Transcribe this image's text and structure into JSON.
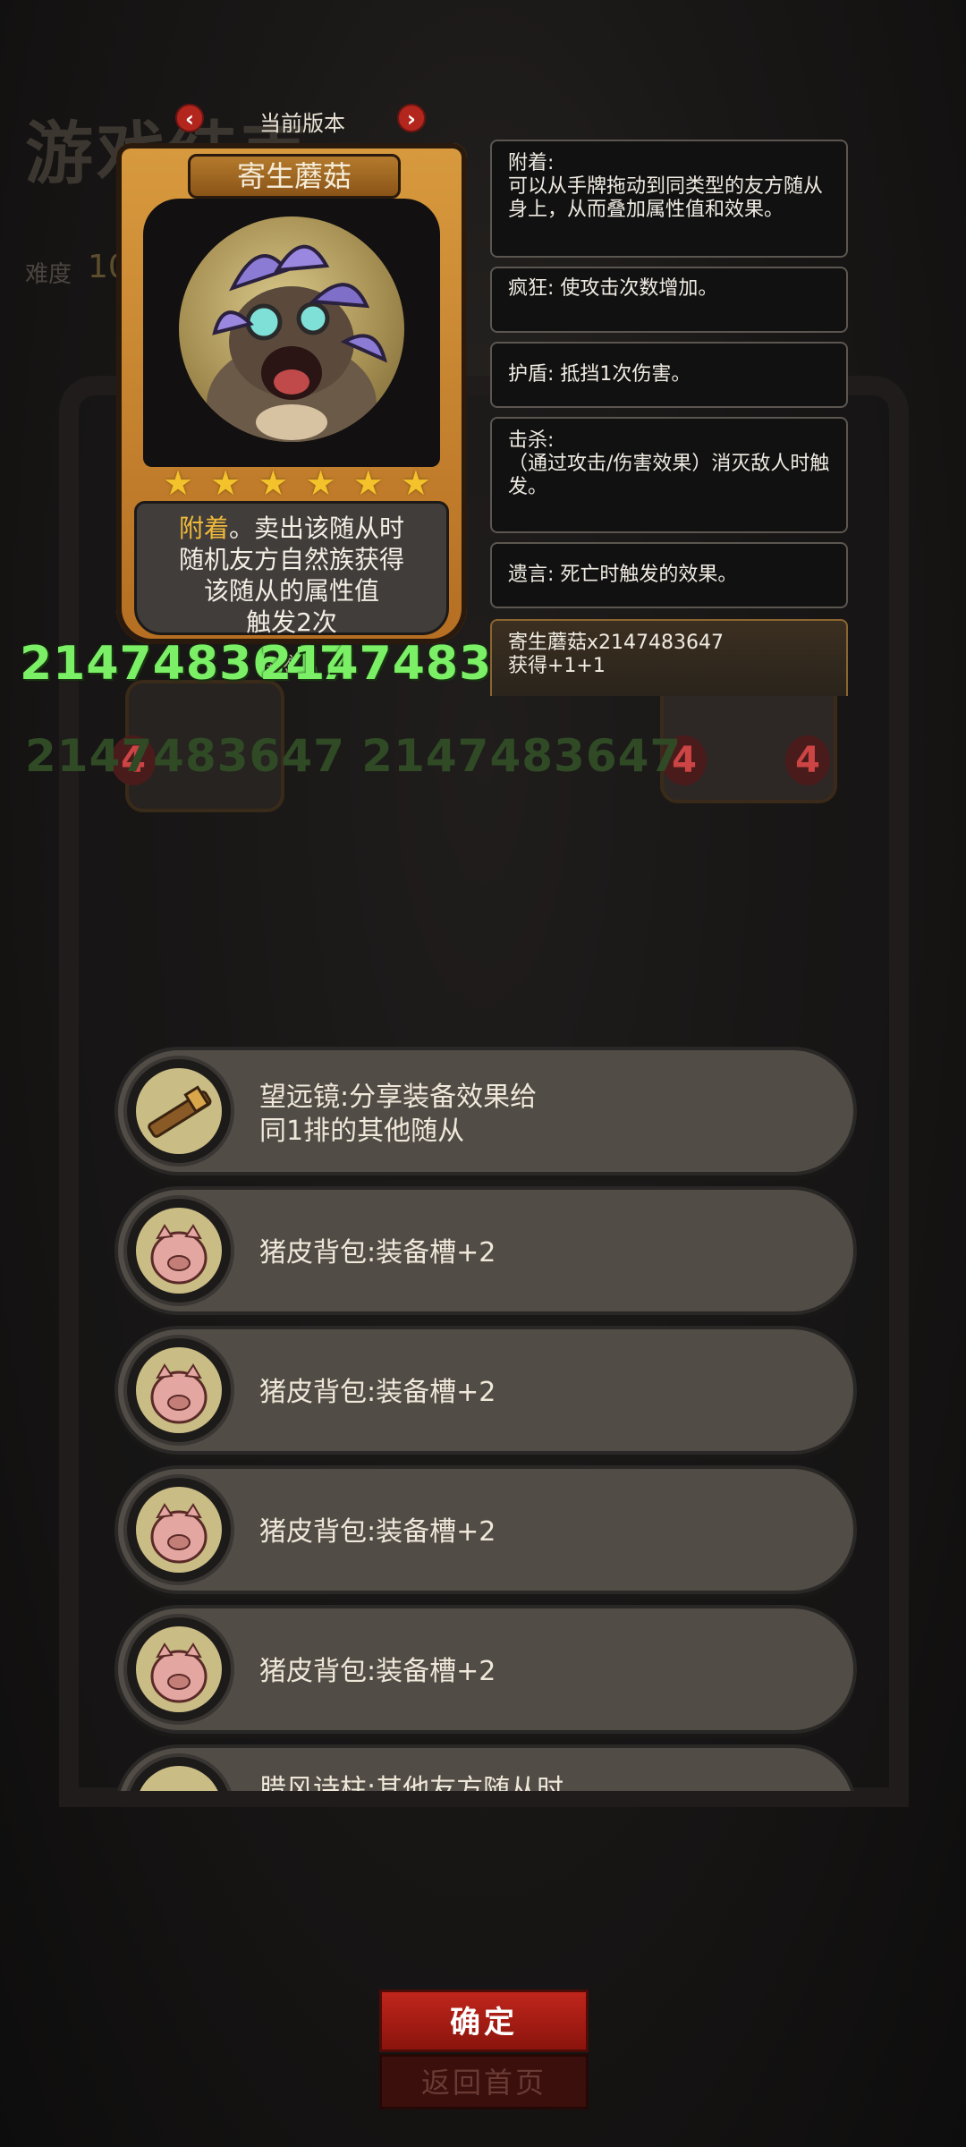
{
  "background": {
    "title": "游戏结束",
    "difficulty_label": "难度",
    "difficulty_value": "10",
    "number_text": "2147483647 2147483647",
    "left_badge": "4",
    "right_badge_left": "4",
    "right_badge_right": "4"
  },
  "version_bar": {
    "label": "当前版本"
  },
  "card": {
    "name": "寄生蘑菇",
    "stars": [
      "★",
      "★",
      "★",
      "★",
      "★",
      "★"
    ],
    "text_keyword": "附着",
    "text_rest_1": "。卖出该随从时",
    "text_line_2": "随机友方自然族获得",
    "text_line_3": "该随从的属性值",
    "text_line_4": "触发2次",
    "tribe": "自然",
    "attack": "2147483647",
    "health": "2147483647"
  },
  "tooltips": [
    {
      "title": "附着:",
      "body": "可以从手牌拖动到同类型的友方随从身上，从而叠加属性值和效果。"
    },
    {
      "title": "",
      "body": "疯狂: 使攻击次数增加。"
    },
    {
      "title": "",
      "body": "护盾: 抵挡1次伤害。"
    },
    {
      "title": "击杀:",
      "body": "（通过攻击/伤害效果）消灭敌人时触发。"
    },
    {
      "title": "",
      "body": "遗言: 死亡时触发的效果。"
    },
    {
      "title": "寄生蘑菇x2147483647",
      "body": "获得+1+1"
    }
  ],
  "equipment": [
    {
      "icon": "telescope-icon",
      "line1": "望远镜:分享装备效果给",
      "line2": "同1排的其他随从"
    },
    {
      "icon": "pig-backpack-icon",
      "line1": "猪皮背包:装备槽+2",
      "line2": ""
    },
    {
      "icon": "pig-backpack-icon",
      "line1": "猪皮背包:装备槽+2",
      "line2": ""
    },
    {
      "icon": "pig-backpack-icon",
      "line1": "猪皮背包:装备槽+2",
      "line2": ""
    },
    {
      "icon": "pig-backpack-icon",
      "line1": "猪皮背包:装备槽+2",
      "line2": ""
    },
    {
      "icon": "scroll-icon",
      "line1": "腊风诗柱:其他友方随从时",
      "line2": ""
    }
  ],
  "buttons": {
    "confirm": "确定",
    "home": "返回首页"
  },
  "colors": {
    "accent_red": "#b3261e",
    "keyword_gold": "#f1b93a",
    "number_green": "#7bf067"
  }
}
